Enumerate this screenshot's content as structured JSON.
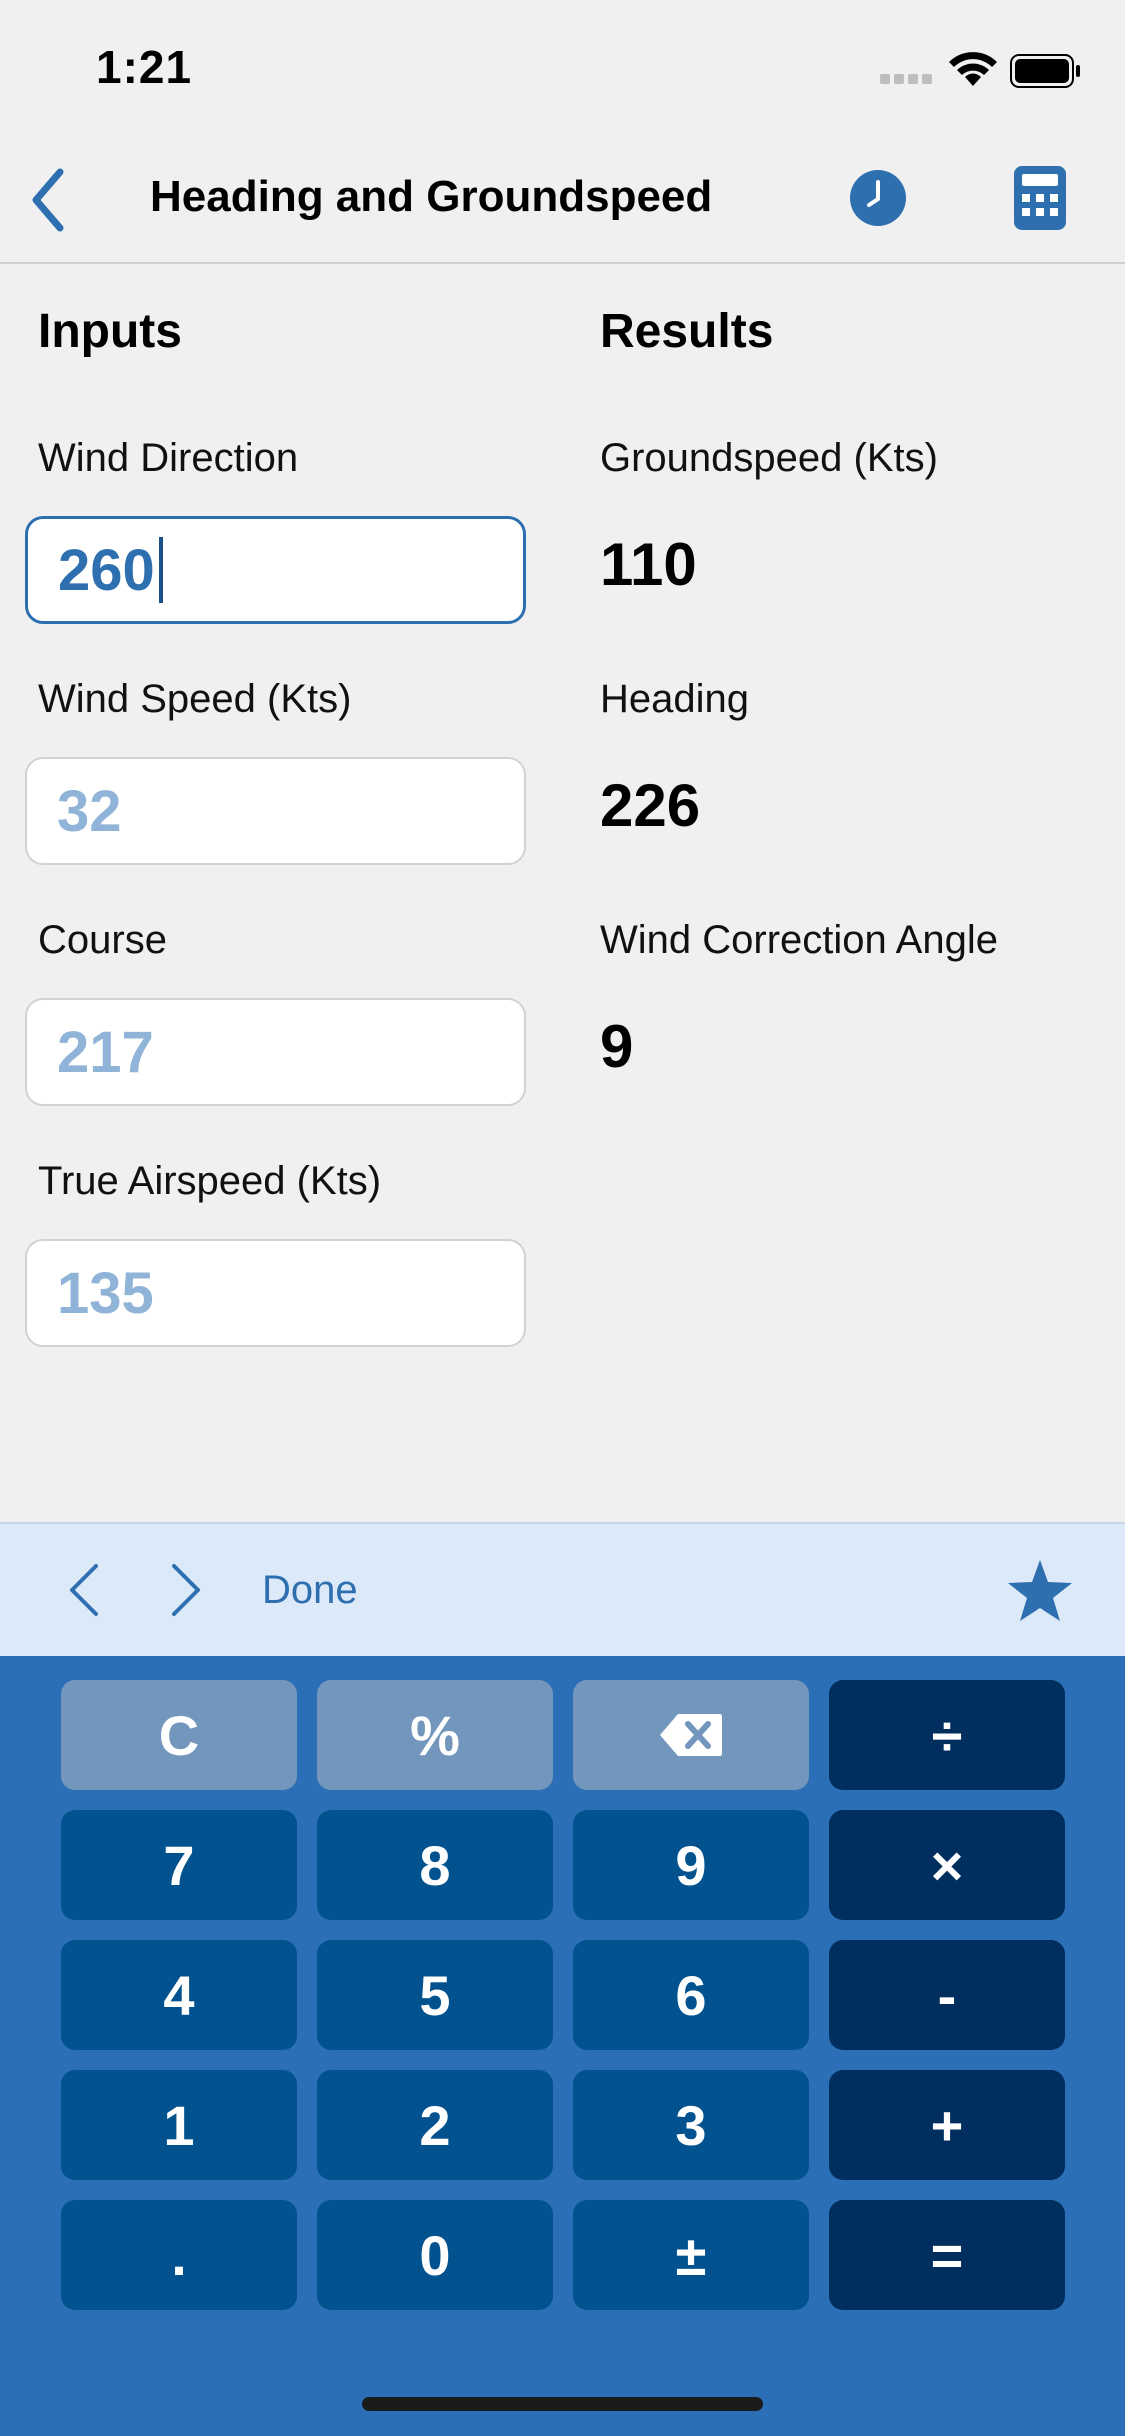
{
  "status_bar": {
    "time": "1:21"
  },
  "header": {
    "back_icon": "chevron-left-icon",
    "title": "Heading and Groundspeed",
    "history_icon": "clock-icon",
    "calculator_icon": "calculator-icon"
  },
  "inputs": {
    "heading": "Inputs",
    "fields": [
      {
        "label": "Wind Direction",
        "value": "260",
        "active": true
      },
      {
        "label": "Wind Speed (Kts)",
        "placeholder": "32"
      },
      {
        "label": "Course",
        "placeholder": "217"
      },
      {
        "label": "True Airspeed (Kts)",
        "placeholder": "135"
      }
    ]
  },
  "results": {
    "heading": "Results",
    "items": [
      {
        "label": "Groundspeed (Kts)",
        "value": "110"
      },
      {
        "label": "Heading",
        "value": "226"
      },
      {
        "label": "Wind Correction Angle",
        "value": "9"
      }
    ]
  },
  "accessory_bar": {
    "prev_icon": "chevron-left-icon",
    "next_icon": "chevron-right-icon",
    "done_label": "Done",
    "favorite_icon": "star-icon"
  },
  "keypad": {
    "rows": [
      [
        "C",
        "%",
        "⌫",
        "÷"
      ],
      [
        "7",
        "8",
        "9",
        "×"
      ],
      [
        "4",
        "5",
        "6",
        "-"
      ],
      [
        "1",
        "2",
        "3",
        "+"
      ],
      [
        ".",
        "0",
        "±",
        "="
      ]
    ]
  },
  "colors": {
    "accent": "#2e6fb0",
    "keypad_background": "#2b70b6",
    "key_function": "#7397bc",
    "key_number": "#01528e",
    "key_operator": "#002e5e",
    "accessory_background": "#dce9f8",
    "placeholder_text": "#8fb4d8"
  }
}
